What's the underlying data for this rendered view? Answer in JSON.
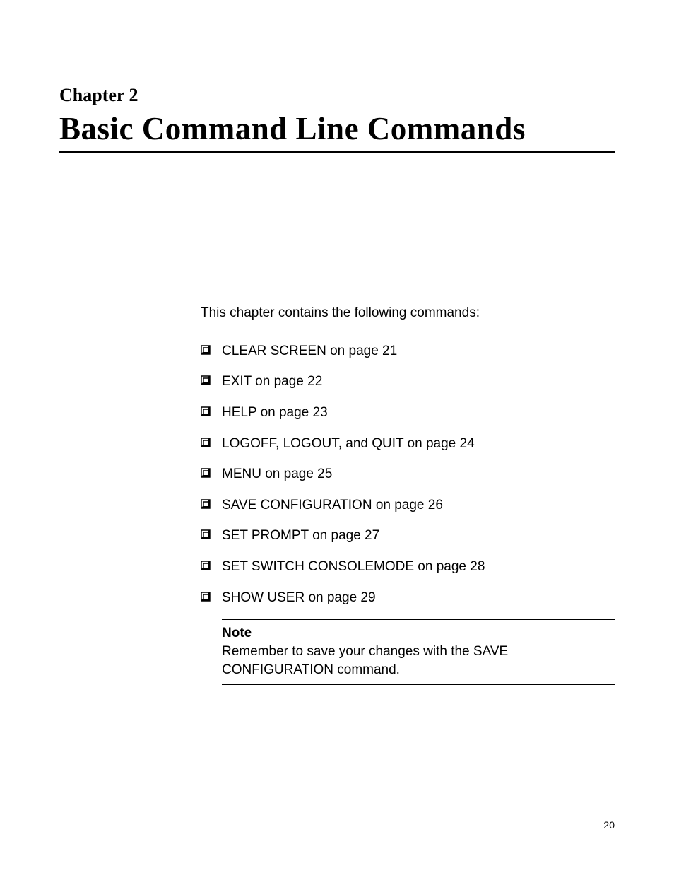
{
  "chapter": {
    "label": "Chapter 2",
    "title": "Basic Command Line Commands"
  },
  "intro": "This chapter contains the following commands:",
  "commands": [
    "CLEAR SCREEN on page 21",
    "EXIT on page 22",
    "HELP on page 23",
    "LOGOFF, LOGOUT, and QUIT on page 24",
    "MENU on page 25",
    "SAVE CONFIGURATION on page 26",
    "SET PROMPT on page 27",
    "SET SWITCH CONSOLEMODE on page 28",
    "SHOW USER on page 29"
  ],
  "note": {
    "label": "Note",
    "text": "Remember to save your changes with the SAVE CONFIGURATION command."
  },
  "page_number": "20"
}
